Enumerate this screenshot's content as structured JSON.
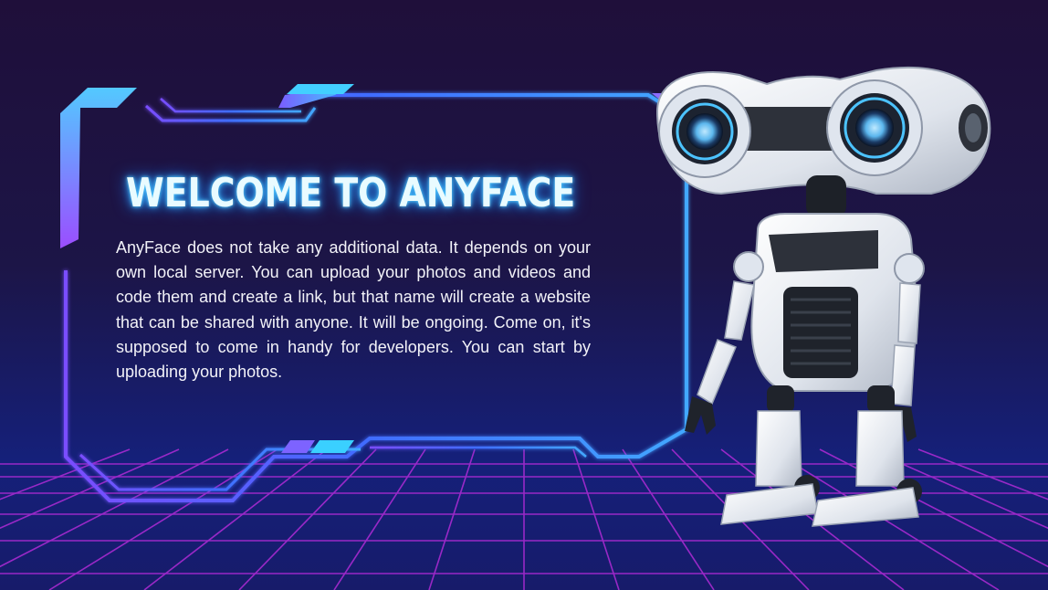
{
  "slide": {
    "title": "WELCOME TO ANYFACE",
    "body": "AnyFace does not take any additional data. It depends on your own local server. You can upload your photos and videos and code them and create a link, but that name will create a website that can be shared with anyone. It will be ongoing. Come on, it's supposed to come in handy for developers. You can start by uploading your photos."
  },
  "colors": {
    "background_top": "#1f0f3a",
    "background_bottom": "#15207a",
    "frame_blue": "#3f6dff",
    "frame_violet": "#8a4dff",
    "frame_cyan": "#3ad0ff",
    "grid": "#b02bd6",
    "title_glow": "#36b4ff"
  },
  "decorations": {
    "frame": "futuristic-hud-frame",
    "floor": "neon-perspective-grid",
    "illustration": "white-robot-binocular-head"
  }
}
